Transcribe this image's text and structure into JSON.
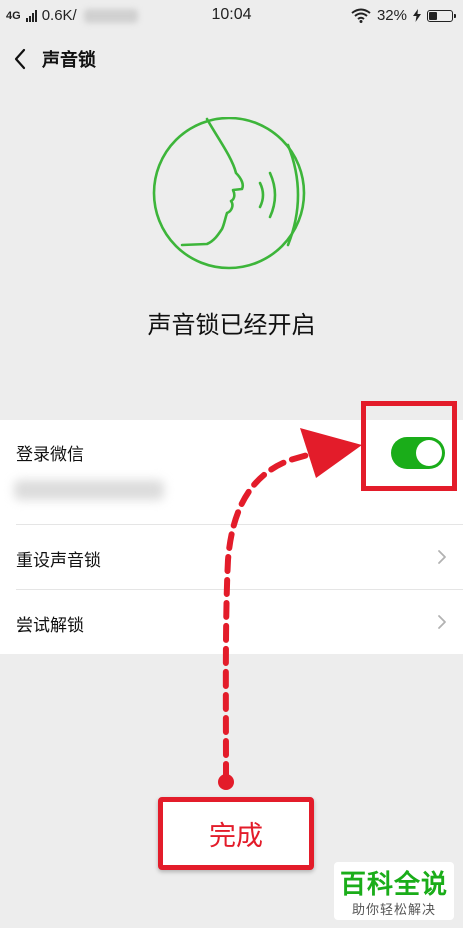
{
  "status_bar": {
    "network": "4G",
    "speed": "0.6K/",
    "time": "10:04",
    "battery_percent_label": "32%",
    "battery_level": 0.32
  },
  "nav": {
    "title": "声音锁"
  },
  "hero": {
    "icon": "voice-face-icon",
    "title": "声音锁已经开启"
  },
  "settings": {
    "login": {
      "label": "登录微信",
      "toggle_on": true
    },
    "reset": {
      "label": "重设声音锁"
    },
    "try": {
      "label": "尝试解锁"
    }
  },
  "annotation": {
    "done_label": "完成",
    "color": "#e31c2a"
  },
  "watermark": {
    "title": "百科全说",
    "subtitle": "助你轻松解决"
  },
  "colors": {
    "accent": "#1aad19",
    "background": "#ededed",
    "annotation": "#e31c2a"
  }
}
